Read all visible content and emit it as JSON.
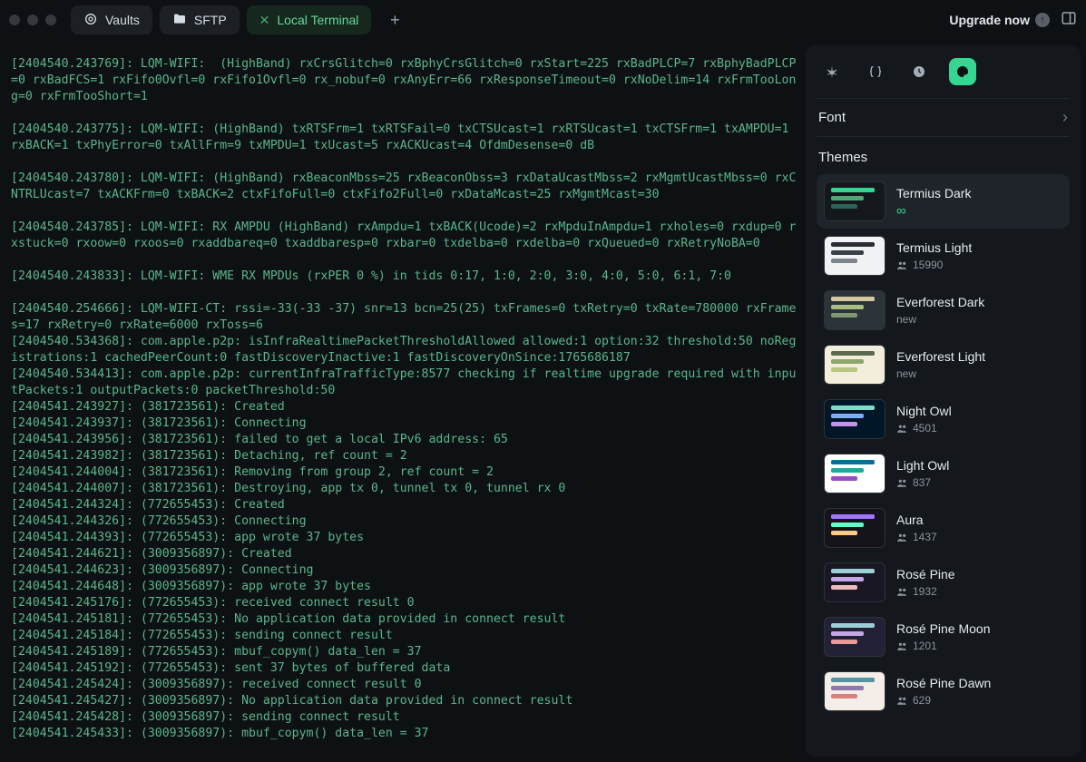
{
  "tabs": [
    {
      "label": "Vaults",
      "icon": "vault"
    },
    {
      "label": "SFTP",
      "icon": "folder"
    },
    {
      "label": "Local Terminal",
      "icon": "close",
      "active": true
    }
  ],
  "titlebar": {
    "upgrade": "Upgrade now"
  },
  "terminal_blocks": [
    "[2404540.243769]: LQM-WIFI:  (HighBand) rxCrsGlitch=0 rxBphyCrsGlitch=0 rxStart=225 rxBadPLCP=7 rxBphyBadPLCP=0 rxBadFCS=1 rxFifo0Ovfl=0 rxFifo1Ovfl=0 rx_nobuf=0 rxAnyErr=66 rxResponseTimeout=0 rxNoDelim=14 rxFrmTooLong=0 rxFrmTooShort=1",
    "[2404540.243775]: LQM-WIFI: (HighBand) txRTSFrm=1 txRTSFail=0 txCTSUcast=1 rxRTSUcast=1 txCTSFrm=1 txAMPDU=1 rxBACK=1 txPhyError=0 txAllFrm=9 txMPDU=1 txUcast=5 rxACKUcast=4 OfdmDesense=0 dB",
    "[2404540.243780]: LQM-WIFI: (HighBand) rxBeaconMbss=25 rxBeaconObss=3 rxDataUcastMbss=2 rxMgmtUcastMbss=0 rxCNTRLUcast=7 txACKFrm=0 txBACK=2 ctxFifoFull=0 ctxFifo2Full=0 rxDataMcast=25 rxMgmtMcast=30",
    "[2404540.243785]: LQM-WIFI: RX AMPDU (HighBand) rxAmpdu=1 txBACK(Ucode)=2 rxMpduInAmpdu=1 rxholes=0 rxdup=0 rxstuck=0 rxoow=0 rxoos=0 rxaddbareq=0 txaddbaresp=0 rxbar=0 txdelba=0 rxdelba=0 rxQueued=0 rxRetryNoBA=0",
    "[2404540.243833]: LQM-WIFI: WME RX MPDUs (rxPER 0 %) in tids 0:17, 1:0, 2:0, 3:0, 4:0, 5:0, 6:1, 7:0"
  ],
  "terminal_lines": [
    "[2404540.254666]: LQM-WIFI-CT: rssi=-33(-33 -37) snr=13 bcn=25(25) txFrames=0 txRetry=0 txRate=780000 rxFrames=17 rxRetry=0 rxRate=6000 rxToss=6",
    "[2404540.534368]: com.apple.p2p: isInfraRealtimePacketThresholdAllowed allowed:1 option:32 threshold:50 noRegistrations:1 cachedPeerCount:0 fastDiscoveryInactive:1 fastDiscoveryOnSince:1765686187",
    "[2404540.534413]: com.apple.p2p: currentInfraTrafficType:8577 checking if realtime upgrade required with inputPackets:1 outputPackets:0 packetThreshold:50",
    "[2404541.243927]: (381723561): Created",
    "[2404541.243937]: (381723561): Connecting",
    "[2404541.243956]: (381723561): failed to get a local IPv6 address: 65",
    "[2404541.243982]: (381723561): Detaching, ref count = 2",
    "[2404541.244004]: (381723561): Removing from group 2, ref count = 2",
    "[2404541.244007]: (381723561): Destroying, app tx 0, tunnel tx 0, tunnel rx 0",
    "[2404541.244324]: (772655453): Created",
    "[2404541.244326]: (772655453): Connecting",
    "[2404541.244393]: (772655453): app wrote 37 bytes",
    "[2404541.244621]: (3009356897): Created",
    "[2404541.244623]: (3009356897): Connecting",
    "[2404541.244648]: (3009356897): app wrote 37 bytes",
    "[2404541.245176]: (772655453): received connect result 0",
    "[2404541.245181]: (772655453): No application data provided in connect result",
    "[2404541.245184]: (772655453): sending connect result",
    "[2404541.245189]: (772655453): mbuf_copym() data_len = 37",
    "[2404541.245192]: (772655453): sent 37 bytes of buffered data",
    "[2404541.245424]: (3009356897): received connect result 0",
    "[2404541.245427]: (3009356897): No application data provided in connect result",
    "[2404541.245428]: (3009356897): sending connect result",
    "[2404541.245433]: (3009356897): mbuf_copym() data_len = 37"
  ],
  "sidebar": {
    "font_label": "Font",
    "themes_label": "Themes",
    "themes": [
      {
        "name": "Termius Dark",
        "sub_type": "infinity",
        "sub": "∞",
        "selected": true,
        "thumb": {
          "bg": "#14181c",
          "bars": [
            "#35d691",
            "#4fa776",
            "#2c645a"
          ]
        }
      },
      {
        "name": "Termius Light",
        "sub_type": "users",
        "sub": "15990",
        "thumb": {
          "bg": "#f0f2f4",
          "bars": [
            "#2a2e33",
            "#3a3f45",
            "#7d848c"
          ]
        }
      },
      {
        "name": "Everforest Dark",
        "sub_type": "new",
        "sub": "new",
        "thumb": {
          "bg": "#2b3339",
          "bars": [
            "#d5c9a1",
            "#a7c080",
            "#7f9872"
          ]
        }
      },
      {
        "name": "Everforest Light",
        "sub_type": "new",
        "sub": "new",
        "thumb": {
          "bg": "#f3eedb",
          "bars": [
            "#5c6a4f",
            "#8da76b",
            "#b9c57e"
          ]
        }
      },
      {
        "name": "Night Owl",
        "sub_type": "users",
        "sub": "4501",
        "thumb": {
          "bg": "#011627",
          "bars": [
            "#7fdbca",
            "#82aaff",
            "#c792ea"
          ]
        }
      },
      {
        "name": "Light Owl",
        "sub_type": "users",
        "sub": "837",
        "thumb": {
          "bg": "#ffffff",
          "bars": [
            "#0b6e99",
            "#2aa298",
            "#994cc3"
          ]
        }
      },
      {
        "name": "Aura",
        "sub_type": "users",
        "sub": "1437",
        "thumb": {
          "bg": "#15141b",
          "bars": [
            "#a277ff",
            "#61ffca",
            "#ffca85"
          ]
        }
      },
      {
        "name": "Rosé Pine",
        "sub_type": "users",
        "sub": "1932",
        "thumb": {
          "bg": "#191724",
          "bars": [
            "#9ccfd8",
            "#c4a7e7",
            "#ebbcba"
          ]
        }
      },
      {
        "name": "Rosé Pine Moon",
        "sub_type": "users",
        "sub": "1201",
        "thumb": {
          "bg": "#232136",
          "bars": [
            "#9ccfd8",
            "#c4a7e7",
            "#ea9a97"
          ]
        }
      },
      {
        "name": "Rosé Pine Dawn",
        "sub_type": "users",
        "sub": "629",
        "thumb": {
          "bg": "#f4ede8",
          "bars": [
            "#56949f",
            "#907aa9",
            "#d7827e"
          ]
        }
      }
    ]
  }
}
